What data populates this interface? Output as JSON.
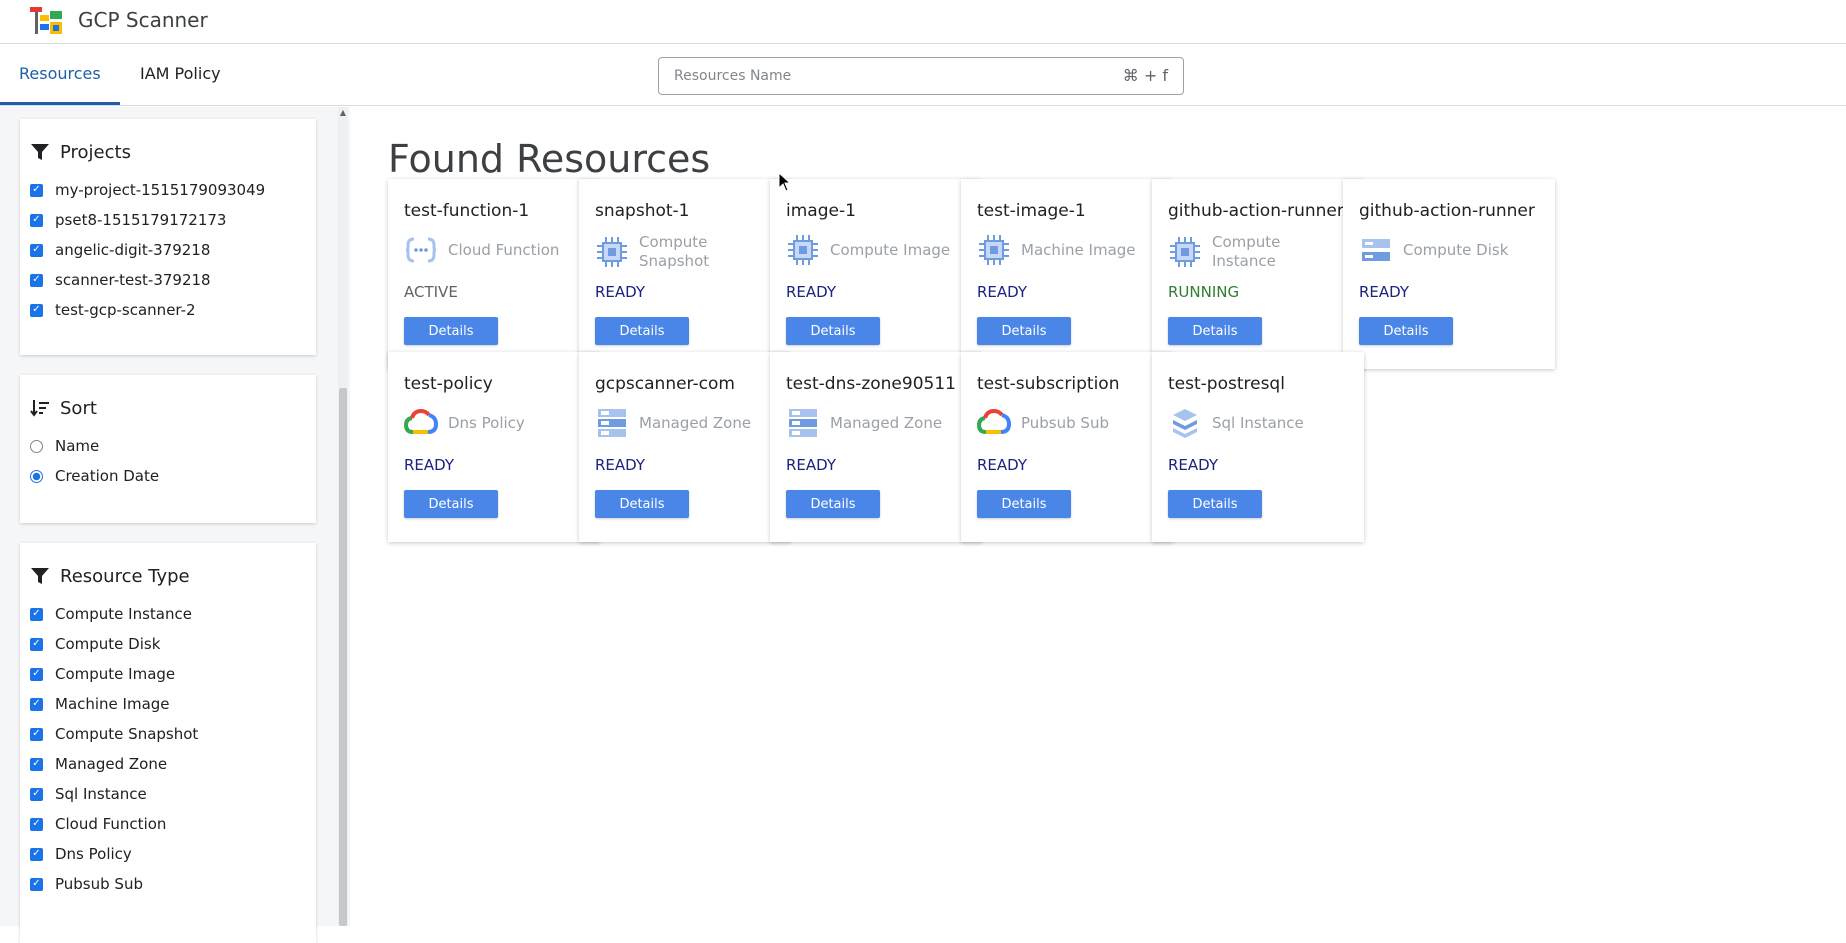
{
  "header": {
    "app_title": "GCP Scanner"
  },
  "nav": {
    "tabs": [
      {
        "label": "Resources"
      },
      {
        "label": "IAM Policy"
      }
    ],
    "search": {
      "placeholder": "Resources Name",
      "shortcut": "⌘ + f"
    }
  },
  "sidebar": {
    "projects": {
      "title": "Projects",
      "items": [
        {
          "label": "my-project-1515179093049",
          "checked": true
        },
        {
          "label": "pset8-1515179172173",
          "checked": true
        },
        {
          "label": "angelic-digit-379218",
          "checked": true
        },
        {
          "label": "scanner-test-379218",
          "checked": true
        },
        {
          "label": "test-gcp-scanner-2",
          "checked": true
        }
      ]
    },
    "sort": {
      "title": "Sort",
      "options": [
        {
          "label": "Name",
          "selected": false
        },
        {
          "label": "Creation Date",
          "selected": true
        }
      ]
    },
    "resource_type": {
      "title": "Resource Type",
      "items": [
        {
          "label": "Compute Instance",
          "checked": true
        },
        {
          "label": "Compute Disk",
          "checked": true
        },
        {
          "label": "Compute Image",
          "checked": true
        },
        {
          "label": "Machine Image",
          "checked": true
        },
        {
          "label": "Compute Snapshot",
          "checked": true
        },
        {
          "label": "Managed Zone",
          "checked": true
        },
        {
          "label": "Sql Instance",
          "checked": true
        },
        {
          "label": "Cloud Function",
          "checked": true
        },
        {
          "label": "Dns Policy",
          "checked": true
        },
        {
          "label": "Pubsub Sub",
          "checked": true
        }
      ]
    }
  },
  "main": {
    "title": "Found Resources",
    "details_label": "Details",
    "cards": [
      {
        "name": "test-function-1",
        "type_line1": "Cloud Function",
        "type_line2": "",
        "icon": "cloud-function-icon",
        "status": "ACTIVE"
      },
      {
        "name": "snapshot-1",
        "type_line1": "Compute",
        "type_line2": "Snapshot",
        "icon": "chip-icon",
        "status": "READY"
      },
      {
        "name": "image-1",
        "type_line1": "Compute Image",
        "type_line2": "",
        "icon": "chip-icon",
        "status": "READY"
      },
      {
        "name": "test-image-1",
        "type_line1": "Machine Image",
        "type_line2": "",
        "icon": "chip-icon",
        "status": "READY"
      },
      {
        "name": "github-action-runner",
        "type_line1": "Compute",
        "type_line2": "Instance",
        "icon": "chip-icon",
        "status": "RUNNING"
      },
      {
        "name": "github-action-runner",
        "type_line1": "Compute Disk",
        "type_line2": "",
        "icon": "disk-icon",
        "status": "READY"
      },
      {
        "name": "test-policy",
        "type_line1": "Dns Policy",
        "type_line2": "",
        "icon": "google-cloud-icon",
        "status": "READY"
      },
      {
        "name": "gcpscanner-com",
        "type_line1": "Managed Zone",
        "type_line2": "",
        "icon": "dns-zone-icon",
        "status": "READY"
      },
      {
        "name": "test-dns-zone90511",
        "type_line1": "Managed Zone",
        "type_line2": "",
        "icon": "dns-zone-icon",
        "status": "READY"
      },
      {
        "name": "test-subscription",
        "type_line1": "Pubsub Sub",
        "type_line2": "",
        "icon": "google-cloud-icon",
        "status": "READY"
      },
      {
        "name": "test-postresql",
        "type_line1": "Sql Instance",
        "type_line2": "",
        "icon": "sql-icon",
        "status": "READY"
      }
    ]
  },
  "colors": {
    "accent": "#1f5fa8",
    "button": "#4a86e8",
    "status_ready": "#1a237e",
    "status_running": "#2e7d32"
  }
}
